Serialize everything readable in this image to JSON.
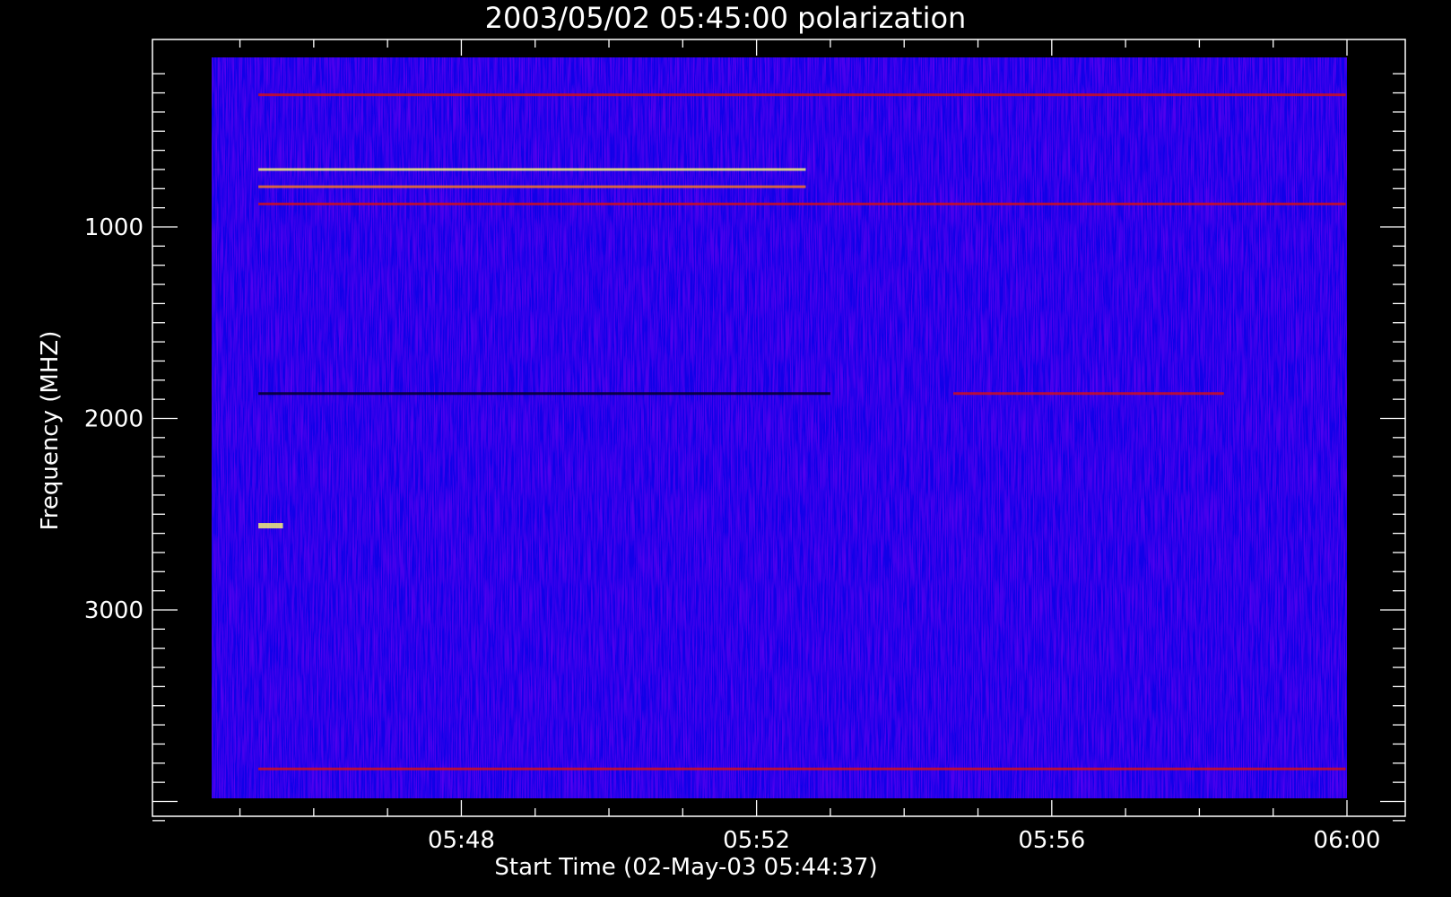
{
  "chart_data": {
    "type": "heatmap",
    "title": "2003/05/02 05:45:00 polarization",
    "xlabel": "Start Time (02-May-03 05:44:37)",
    "ylabel": "Frequency (MHZ)",
    "x_range": [
      "05:44:37",
      "06:00:00"
    ],
    "y_range_mhz": [
      4200,
      100
    ],
    "x_tick_labels": [
      "05:48",
      "05:52",
      "05:56",
      "06:00"
    ],
    "y_tick_labels": [
      "1000",
      "2000",
      "3000"
    ],
    "colormap": [
      "#000000",
      "#1a00ff",
      "#cc0000",
      "#ffff66"
    ],
    "background_level": "blue",
    "features": [
      {
        "freq_mhz": 310,
        "t_start": "05:45:15",
        "t_end": "05:59:59",
        "intensity": "red"
      },
      {
        "freq_mhz": 700,
        "t_start": "05:45:15",
        "t_end": "05:52:40",
        "intensity": "yellow"
      },
      {
        "freq_mhz": 790,
        "t_start": "05:45:15",
        "t_end": "05:52:40",
        "intensity": "orange"
      },
      {
        "freq_mhz": 880,
        "t_start": "05:45:15",
        "t_end": "05:59:59",
        "intensity": "red"
      },
      {
        "freq_mhz": 1870,
        "t_start": "05:45:15",
        "t_end": "05:53:00",
        "intensity": "dark"
      },
      {
        "freq_mhz": 1870,
        "t_start": "05:54:40",
        "t_end": "05:58:20",
        "intensity": "red"
      },
      {
        "freq_mhz": 2560,
        "t_start": "05:45:15",
        "t_end": "05:45:35",
        "intensity": "yellow"
      },
      {
        "freq_mhz": 3830,
        "t_start": "05:45:15",
        "t_end": "05:59:59",
        "intensity": "red"
      }
    ]
  }
}
